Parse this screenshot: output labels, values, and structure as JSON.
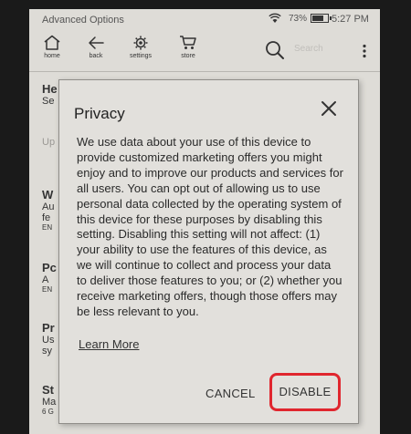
{
  "status_bar": {
    "title": "Advanced Options",
    "battery_percent": "73%",
    "time": "5:27 PM"
  },
  "toolbar": {
    "home_label": "home",
    "back_label": "back",
    "settings_label": "settings",
    "store_label": "store",
    "search_placeholder": "Search"
  },
  "background_items": [
    {
      "heading": "He",
      "sub": "Se"
    },
    {
      "heading": "",
      "sub": "Up"
    },
    {
      "heading": "W",
      "sub": "Au",
      "sub2": "fe",
      "sub3": "EN"
    },
    {
      "heading": "Pc",
      "sub": "A",
      "sub2": "EN"
    },
    {
      "heading": "Pr",
      "sub": "Us",
      "sub2": "sy"
    },
    {
      "heading": "St",
      "sub": "Ma",
      "sub2": "6 G"
    }
  ],
  "dialog": {
    "title": "Privacy",
    "body": "We use data about your use of this device to provide customized marketing offers you might enjoy and to improve our products and services for all users. You can opt out of allowing us to use personal data collected by the operating system of this device for these purposes by disabling this setting. Disabling this setting will not affect: (1) your ability to use the features of this device, as we will continue to collect and process your data to deliver those features to you; or (2) whether you receive marketing offers, though those offers may be less relevant to you.",
    "learn_more": "Learn More",
    "cancel_label": "CANCEL",
    "disable_label": "DISABLE",
    "highlight_color": "#e0262e"
  }
}
